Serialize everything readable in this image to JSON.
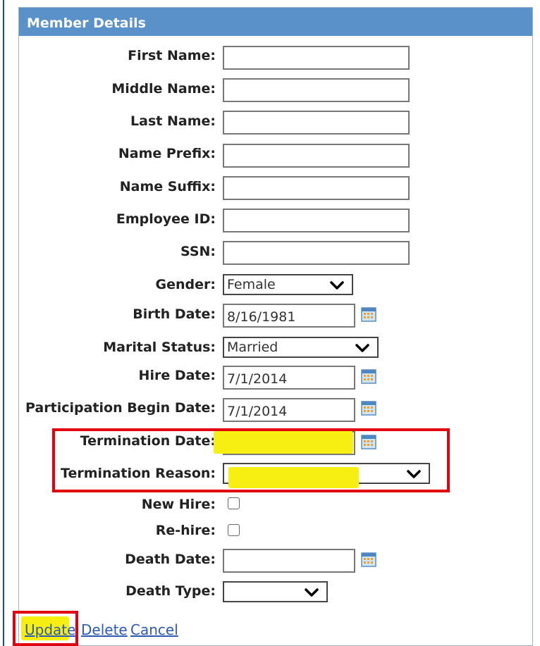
{
  "panel": {
    "title": "Member Details"
  },
  "fields": {
    "first_name": {
      "label": "First Name:",
      "value": ""
    },
    "middle_name": {
      "label": "Middle Name:",
      "value": ""
    },
    "last_name": {
      "label": "Last Name:",
      "value": ""
    },
    "name_prefix": {
      "label": "Name Prefix:",
      "value": ""
    },
    "name_suffix": {
      "label": "Name Suffix:",
      "value": ""
    },
    "employee_id": {
      "label": "Employee ID:",
      "value": ""
    },
    "ssn": {
      "label": "SSN:",
      "value": ""
    },
    "gender": {
      "label": "Gender:",
      "value": "Female"
    },
    "birth_date": {
      "label": "Birth Date:",
      "value": "8/16/1981"
    },
    "marital_status": {
      "label": "Marital Status:",
      "value": "Married"
    },
    "hire_date": {
      "label": "Hire Date:",
      "value": "7/1/2014"
    },
    "participation_begin_date": {
      "label": "Participation Begin Date:",
      "value": "7/1/2014"
    },
    "termination_date": {
      "label": "Termination Date:",
      "value": ""
    },
    "termination_reason": {
      "label": "Termination Reason:",
      "value": ""
    },
    "new_hire": {
      "label": "New Hire:",
      "checked": false
    },
    "re_hire": {
      "label": "Re-hire:",
      "checked": false
    },
    "death_date": {
      "label": "Death Date:",
      "value": ""
    },
    "death_type": {
      "label": "Death Type:",
      "value": ""
    }
  },
  "actions": {
    "update": "Update",
    "delete": "Delete",
    "cancel": "Cancel"
  },
  "icons": {
    "calendar": "calendar-icon",
    "dropdown": "chevron-down-icon"
  },
  "colors": {
    "header": "#5b91c9",
    "annotation_box": "#e00010",
    "highlight": "#f7ef12",
    "link": "#2d5bb4"
  }
}
